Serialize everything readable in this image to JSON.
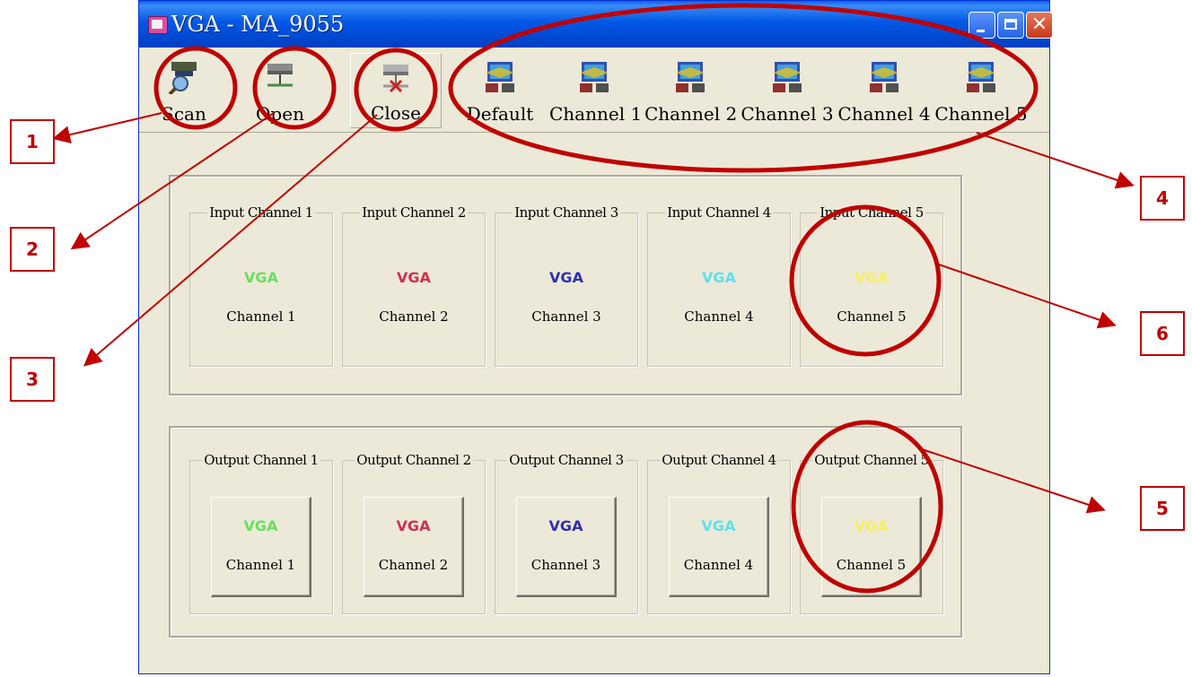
{
  "window": {
    "title": "VGA - MA_9055"
  },
  "toolbar": {
    "scan": "Scan",
    "open": "Open",
    "close": "Close",
    "default": "Default",
    "channels": [
      "Channel 1",
      "Channel 2",
      "Channel 3",
      "Channel 4",
      "Channel 5"
    ]
  },
  "input_panel": {
    "groups": [
      {
        "title": "Input Channel 1",
        "signal": "VGA",
        "label": "Channel 1",
        "color": "#66e060"
      },
      {
        "title": "Input Channel 2",
        "signal": "VGA",
        "label": "Channel 2",
        "color": "#d03050"
      },
      {
        "title": "Input Channel 3",
        "signal": "VGA",
        "label": "Channel 3",
        "color": "#3030b0"
      },
      {
        "title": "Input Channel 4",
        "signal": "VGA",
        "label": "Channel 4",
        "color": "#60e0ec"
      },
      {
        "title": "Input Channel 5",
        "signal": "VGA",
        "label": "Channel 5",
        "color": "#f4f060"
      }
    ]
  },
  "output_panel": {
    "groups": [
      {
        "title": "Output Channel 1",
        "signal": "VGA",
        "label": "Channel 1",
        "color": "#66e060"
      },
      {
        "title": "Output Channel 2",
        "signal": "VGA",
        "label": "Channel 2",
        "color": "#d03050"
      },
      {
        "title": "Output Channel 3",
        "signal": "VGA",
        "label": "Channel 3",
        "color": "#3030b0"
      },
      {
        "title": "Output Channel 4",
        "signal": "VGA",
        "label": "Channel 4",
        "color": "#60e0ec"
      },
      {
        "title": "Output Channel 5",
        "signal": "VGA",
        "label": "Channel 5",
        "color": "#f4f060"
      }
    ]
  },
  "annotations": [
    "1",
    "2",
    "3",
    "4",
    "5",
    "6"
  ],
  "colors": {
    "annotation": "#c00000",
    "window_bg": "#ece9d8",
    "titlebar": "#0058e6"
  }
}
